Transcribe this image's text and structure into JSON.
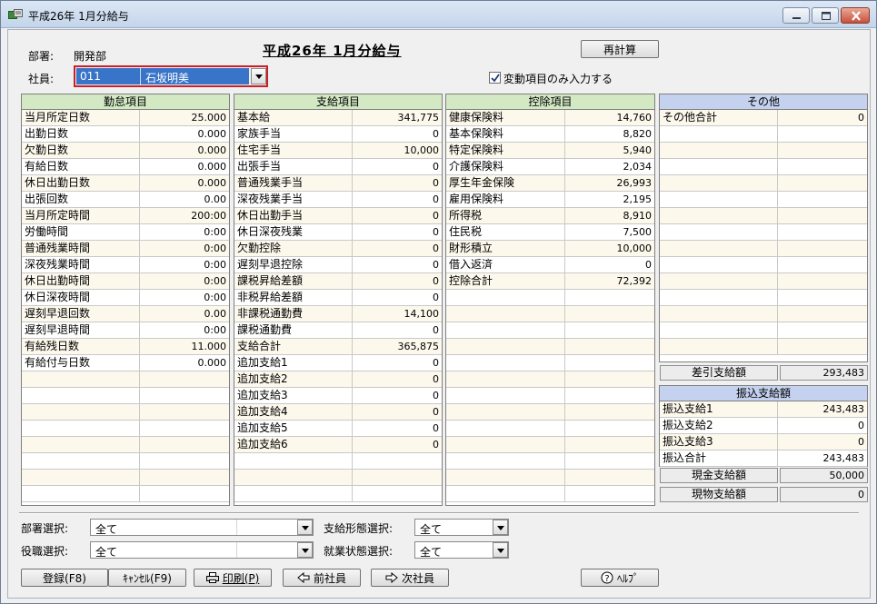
{
  "window": {
    "title": "平成26年 1月分給与"
  },
  "header": {
    "dept_label": "部署:",
    "dept_value": "開発部",
    "emp_label": "社員:",
    "emp_code": "011",
    "emp_name": "石坂明美",
    "page_title": "平成26年 1月分給与",
    "recalc_button": "再計算",
    "checkbox_label": "変動項目のみ入力する",
    "checkbox_checked": true
  },
  "attendance": {
    "title": "勤怠項目",
    "header_color": "#d2e9c4",
    "rows": [
      {
        "name": "当月所定日数",
        "value": "25.000"
      },
      {
        "name": "出勤日数",
        "value": "0.000"
      },
      {
        "name": "欠勤日数",
        "value": "0.000"
      },
      {
        "name": "有給日数",
        "value": "0.000"
      },
      {
        "name": "休日出勤日数",
        "value": "0.000"
      },
      {
        "name": "出張回数",
        "value": "0.00"
      },
      {
        "name": "当月所定時間",
        "value": "200:00"
      },
      {
        "name": "労働時間",
        "value": "0:00"
      },
      {
        "name": "普通残業時間",
        "value": "0:00"
      },
      {
        "name": "深夜残業時間",
        "value": "0:00"
      },
      {
        "name": "休日出勤時間",
        "value": "0:00"
      },
      {
        "name": "休日深夜時間",
        "value": "0:00"
      },
      {
        "name": "遅刻早退回数",
        "value": "0.00"
      },
      {
        "name": "遅刻早退時間",
        "value": "0:00"
      },
      {
        "name": "有給残日数",
        "value": "11.000"
      },
      {
        "name": "有給付与日数",
        "value": "0.000"
      },
      {
        "name": "",
        "value": ""
      },
      {
        "name": "",
        "value": ""
      },
      {
        "name": "",
        "value": ""
      },
      {
        "name": "",
        "value": ""
      },
      {
        "name": "",
        "value": ""
      },
      {
        "name": "",
        "value": ""
      },
      {
        "name": "",
        "value": ""
      },
      {
        "name": "",
        "value": ""
      }
    ]
  },
  "payments": {
    "title": "支給項目",
    "header_color": "#d2e9c4",
    "rows": [
      {
        "name": "基本給",
        "value": "341,775"
      },
      {
        "name": "家族手当",
        "value": "0"
      },
      {
        "name": "住宅手当",
        "value": "10,000"
      },
      {
        "name": "出張手当",
        "value": "0"
      },
      {
        "name": "普通残業手当",
        "value": "0"
      },
      {
        "name": "深夜残業手当",
        "value": "0"
      },
      {
        "name": "休日出勤手当",
        "value": "0"
      },
      {
        "name": "休日深夜残業",
        "value": "0"
      },
      {
        "name": "欠勤控除",
        "value": "0"
      },
      {
        "name": "遅刻早退控除",
        "value": "0"
      },
      {
        "name": "課税昇給差額",
        "value": "0"
      },
      {
        "name": "非税昇給差額",
        "value": "0"
      },
      {
        "name": "非課税通勤費",
        "value": "14,100"
      },
      {
        "name": "課税通勤費",
        "value": "0"
      },
      {
        "name": "支給合計",
        "value": "365,875"
      },
      {
        "name": "追加支給1",
        "value": "0"
      },
      {
        "name": "追加支給2",
        "value": "0"
      },
      {
        "name": "追加支給3",
        "value": "0"
      },
      {
        "name": "追加支給4",
        "value": "0"
      },
      {
        "name": "追加支給5",
        "value": "0"
      },
      {
        "name": "追加支給6",
        "value": "0"
      },
      {
        "name": "",
        "value": ""
      },
      {
        "name": "",
        "value": ""
      },
      {
        "name": "",
        "value": ""
      }
    ]
  },
  "deductions": {
    "title": "控除項目",
    "header_color": "#d2e9c4",
    "rows": [
      {
        "name": "健康保険料",
        "value": "14,760"
      },
      {
        "name": " 基本保険料",
        "value": "8,820"
      },
      {
        "name": " 特定保険料",
        "value": "5,940"
      },
      {
        "name": "介護保険料",
        "value": "2,034"
      },
      {
        "name": "厚生年金保険",
        "value": "26,993"
      },
      {
        "name": "雇用保険料",
        "value": "2,195"
      },
      {
        "name": "所得税",
        "value": "8,910"
      },
      {
        "name": "住民税",
        "value": "7,500"
      },
      {
        "name": "財形積立",
        "value": "10,000"
      },
      {
        "name": "借入返済",
        "value": "0"
      },
      {
        "name": "控除合計",
        "value": "72,392"
      },
      {
        "name": "",
        "value": ""
      },
      {
        "name": "",
        "value": ""
      },
      {
        "name": "",
        "value": ""
      },
      {
        "name": "",
        "value": ""
      },
      {
        "name": "",
        "value": ""
      },
      {
        "name": "",
        "value": ""
      },
      {
        "name": "",
        "value": ""
      },
      {
        "name": "",
        "value": ""
      },
      {
        "name": "",
        "value": ""
      },
      {
        "name": "",
        "value": ""
      },
      {
        "name": "",
        "value": ""
      },
      {
        "name": "",
        "value": ""
      },
      {
        "name": "",
        "value": ""
      }
    ]
  },
  "other": {
    "title": "その他",
    "header_color": "#c4d2f0",
    "rows": [
      {
        "name": "その他合計",
        "value": "0"
      },
      {
        "name": "",
        "value": ""
      },
      {
        "name": "",
        "value": ""
      },
      {
        "name": "",
        "value": ""
      },
      {
        "name": "",
        "value": ""
      },
      {
        "name": "",
        "value": ""
      },
      {
        "name": "",
        "value": ""
      },
      {
        "name": "",
        "value": ""
      },
      {
        "name": "",
        "value": ""
      },
      {
        "name": "",
        "value": ""
      },
      {
        "name": "",
        "value": ""
      },
      {
        "name": "",
        "value": ""
      },
      {
        "name": "",
        "value": ""
      },
      {
        "name": "",
        "value": ""
      },
      {
        "name": "",
        "value": ""
      }
    ]
  },
  "net_pay": {
    "label": "差引支給額",
    "value": "293,483"
  },
  "transfer": {
    "title": "振込支給額",
    "rows": [
      {
        "name": "振込支給1",
        "value": "243,483"
      },
      {
        "name": "振込支給2",
        "value": "0"
      },
      {
        "name": "振込支給3",
        "value": "0"
      },
      {
        "name": "振込合計",
        "value": "243,483"
      }
    ]
  },
  "cash": {
    "label": "現金支給額",
    "value": "50,000"
  },
  "goods": {
    "label": "現物支給額",
    "value": "0"
  },
  "filters": {
    "dept_label": "部署選択:",
    "dept_value": "全て",
    "position_label": "役職選択:",
    "position_value": "全て",
    "paytype_label": "支給形態選択:",
    "paytype_value": "全て",
    "employment_label": "就業状態選択:",
    "employment_value": "全て"
  },
  "buttons": {
    "register": "登録(F8)",
    "cancel": "ｷｬﾝｾﾙ(F9)",
    "print": "印刷(P)",
    "prev": "前社員",
    "next": "次社員",
    "help": "ﾍﾙﾌﾟ"
  }
}
